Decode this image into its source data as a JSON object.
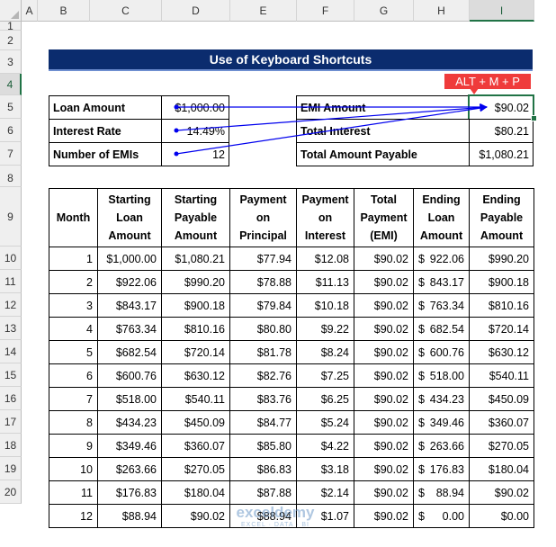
{
  "columns": [
    "A",
    "B",
    "C",
    "D",
    "E",
    "F",
    "G",
    "H",
    "I"
  ],
  "rows": [
    "1",
    "2",
    "3",
    "4",
    "5",
    "6",
    "7",
    "8",
    "9",
    "10",
    "11",
    "12",
    "13",
    "14",
    "15",
    "16",
    "17",
    "18",
    "19",
    "20"
  ],
  "title": "Use of Keyboard Shortcuts",
  "shortcut_tip": "ALT + M + P",
  "inputs": [
    {
      "label": "Loan Amount",
      "value": "$1,000.00"
    },
    {
      "label": "Interest Rate",
      "value": "14.49%"
    },
    {
      "label": "Number of EMIs",
      "value": "12"
    }
  ],
  "outputs": [
    {
      "label": "EMI Amount",
      "value": "$90.02"
    },
    {
      "label": "Total Interest",
      "value": "$80.21"
    },
    {
      "label": "Total Amount Payable",
      "value": "$1,080.21"
    }
  ],
  "table": {
    "headers": [
      "Month",
      "Starting Loan Amount",
      "Starting Payable Amount",
      "Payment on Principal",
      "Payment on Interest",
      "Total Payment (EMI)",
      "Ending Loan Amount",
      "Ending Payable Amount"
    ],
    "rows": [
      [
        "1",
        "$1,000.00",
        "$1,080.21",
        "$77.94",
        "$12.08",
        "$90.02",
        [
          "$",
          "922.06"
        ],
        "$990.20"
      ],
      [
        "2",
        "$922.06",
        "$990.20",
        "$78.88",
        "$11.13",
        "$90.02",
        [
          "$",
          "843.17"
        ],
        "$900.18"
      ],
      [
        "3",
        "$843.17",
        "$900.18",
        "$79.84",
        "$10.18",
        "$90.02",
        [
          "$",
          "763.34"
        ],
        "$810.16"
      ],
      [
        "4",
        "$763.34",
        "$810.16",
        "$80.80",
        "$9.22",
        "$90.02",
        [
          "$",
          "682.54"
        ],
        "$720.14"
      ],
      [
        "5",
        "$682.54",
        "$720.14",
        "$81.78",
        "$8.24",
        "$90.02",
        [
          "$",
          "600.76"
        ],
        "$630.12"
      ],
      [
        "6",
        "$600.76",
        "$630.12",
        "$82.76",
        "$7.25",
        "$90.02",
        [
          "$",
          "518.00"
        ],
        "$540.11"
      ],
      [
        "7",
        "$518.00",
        "$540.11",
        "$83.76",
        "$6.25",
        "$90.02",
        [
          "$",
          "434.23"
        ],
        "$450.09"
      ],
      [
        "8",
        "$434.23",
        "$450.09",
        "$84.77",
        "$5.24",
        "$90.02",
        [
          "$",
          "349.46"
        ],
        "$360.07"
      ],
      [
        "9",
        "$349.46",
        "$360.07",
        "$85.80",
        "$4.22",
        "$90.02",
        [
          "$",
          "263.66"
        ],
        "$270.05"
      ],
      [
        "10",
        "$263.66",
        "$270.05",
        "$86.83",
        "$3.18",
        "$90.02",
        [
          "$",
          "176.83"
        ],
        "$180.04"
      ],
      [
        "11",
        "$176.83",
        "$180.04",
        "$87.88",
        "$2.14",
        "$90.02",
        [
          "$",
          "88.94"
        ],
        "$90.02"
      ],
      [
        "12",
        "$88.94",
        "$90.02",
        "$88.94",
        "$1.07",
        "$90.02",
        [
          "$",
          "0.00"
        ],
        "$0.00"
      ]
    ]
  },
  "watermark": {
    "brand": "exceldemy",
    "tagline": "EXCEL · DATA · BI"
  },
  "colors": {
    "title_bg": "#0b2c6e",
    "tip_bg": "#ef3b3b",
    "selection": "#217346",
    "arrows": "#0000ee"
  }
}
